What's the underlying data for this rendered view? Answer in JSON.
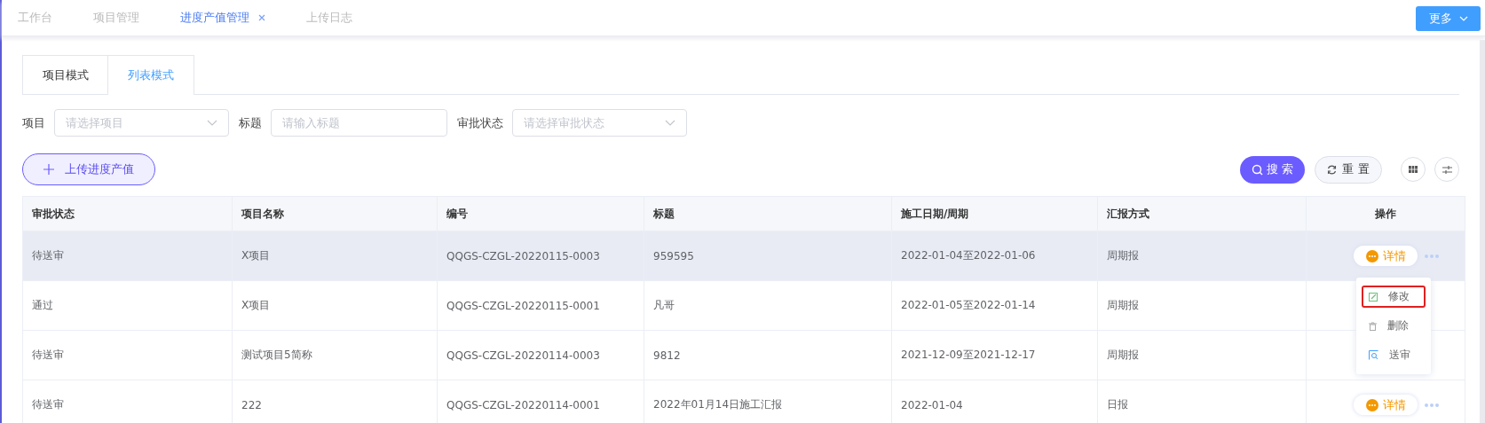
{
  "top_tabs": [
    {
      "label": "工作台",
      "selected": false,
      "closable": false
    },
    {
      "label": "项目管理",
      "selected": false,
      "closable": false
    },
    {
      "label": "进度产值管理",
      "selected": true,
      "closable": true
    },
    {
      "label": "上传日志",
      "selected": false,
      "closable": false
    }
  ],
  "more_button": "更多",
  "mode_tabs": [
    {
      "label": "项目模式",
      "selected": false
    },
    {
      "label": "列表模式",
      "selected": true
    }
  ],
  "filters": [
    {
      "label": "项目",
      "kind": "select",
      "placeholder": "请选择项目"
    },
    {
      "label": "标题",
      "kind": "input",
      "placeholder": "请输入标题"
    },
    {
      "label": "审批状态",
      "kind": "select",
      "placeholder": "请选择审批状态"
    }
  ],
  "upload_button": "上传进度产值",
  "search_button": "搜 索",
  "reset_button": "重 置",
  "table": {
    "columns": [
      "审批状态",
      "项目名称",
      "编号",
      "标题",
      "施工日期/周期",
      "汇报方式",
      "操作"
    ],
    "rows": [
      {
        "cells": [
          "待送审",
          "X项目",
          "QQGS-CZGL-20220115-0003",
          "959595",
          "2022-01-04至2022-01-06",
          "周期报"
        ],
        "detail": "详情",
        "hovered": true
      },
      {
        "cells": [
          "通过",
          "X项目",
          "QQGS-CZGL-20220115-0001",
          "凡哥",
          "2022-01-05至2022-01-14",
          "周期报"
        ],
        "hovered": false
      },
      {
        "cells": [
          "待送审",
          "测试项目5简称",
          "QQGS-CZGL-20220114-0003",
          "9812",
          "2021-12-09至2021-12-17",
          "周期报"
        ],
        "hovered": false
      },
      {
        "cells": [
          "待送审",
          "222",
          "QQGS-CZGL-20220114-0001",
          "2022年01月14日施工汇报",
          "2022-01-04",
          "日报"
        ],
        "detail": "详情",
        "hovered": false
      }
    ]
  },
  "action_menu": [
    {
      "label": "修改",
      "kind": "edit",
      "outlined": true
    },
    {
      "label": "删除",
      "kind": "delete",
      "outlined": false
    },
    {
      "label": "送审",
      "kind": "submit",
      "outlined": false
    }
  ]
}
